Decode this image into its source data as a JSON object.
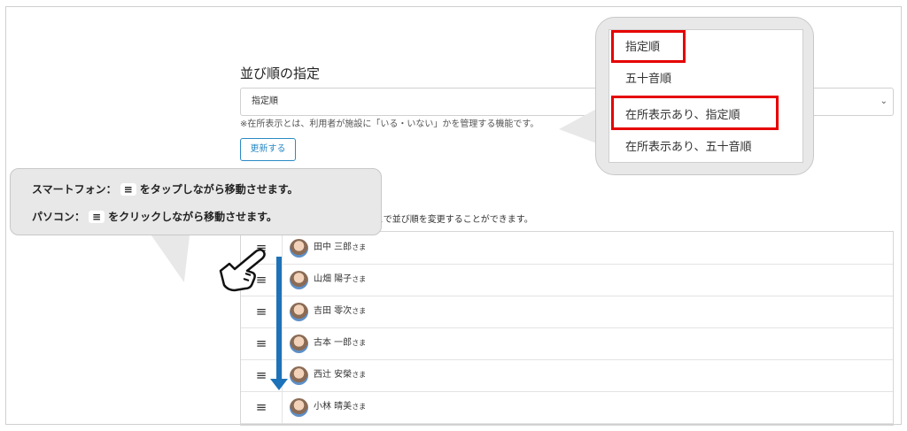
{
  "page": {
    "title": "並び順の指定",
    "select_value": "指定順",
    "note": "※在所表示とは、利用者が施設に「いる・いない」かを管理する機能です。",
    "update_button": "更新する",
    "hint_partial": "とで並び順を変更することができます。"
  },
  "residents": [
    {
      "name": "田中 三郎",
      "suffix": "さま"
    },
    {
      "name": "山畑 陽子",
      "suffix": "さま"
    },
    {
      "name": "吉田 零次",
      "suffix": "さま"
    },
    {
      "name": "古本 一郎",
      "suffix": "さま"
    },
    {
      "name": "西辻 安榮",
      "suffix": "さま"
    },
    {
      "name": "小林 晴美",
      "suffix": "さま"
    }
  ],
  "handle_glyph": "≡",
  "dropdown": {
    "options": [
      "指定順",
      "五十音順",
      "在所表示あり、指定順",
      "在所表示あり、五十音順"
    ],
    "highlighted": [
      "指定順",
      "在所表示あり、指定順"
    ]
  },
  "callout": {
    "line1_prefix": "スマートフォン：",
    "line1_key": "≡",
    "line1_suffix": "をタップしながら移動させます。",
    "line2_prefix": "パソコン：",
    "line2_key": "≡",
    "line2_suffix": "をクリックしながら移動させます。"
  },
  "colors": {
    "accent": "#2a8ac4",
    "highlight": "#e60000",
    "arrow": "#1e73b8"
  },
  "icons": [
    "chevron-down-icon",
    "drag-handle-icon",
    "pointing-hand-icon",
    "down-arrow-icon"
  ]
}
